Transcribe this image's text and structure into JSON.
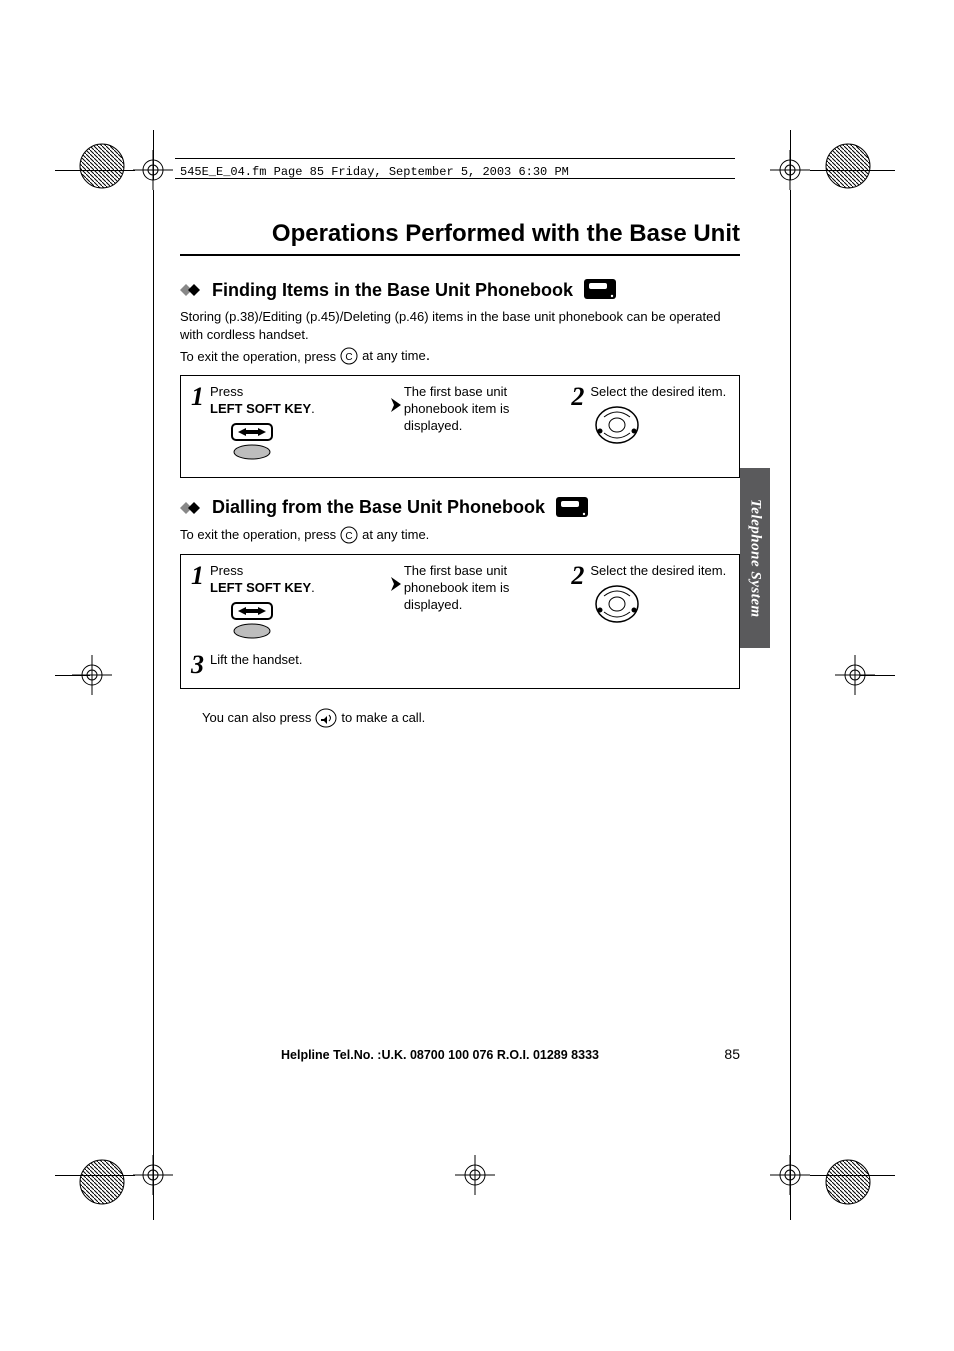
{
  "running_head": "545E_E_04.fm  Page 85  Friday, September 5, 2003  6:30 PM",
  "doc_title": "Operations Performed with the Base Unit",
  "side_tab": "Telephone System",
  "helpline": "Helpline Tel.No. :U.K. 08700 100 076  R.O.I. 01289 8333",
  "page_number": "85",
  "section1": {
    "title": "Finding Items in the Base Unit Phonebook",
    "intro1": "Storing (p.38)/Editing (p.45)/Deleting (p.46) items in the base unit phonebook can be operated with cordless handset.",
    "exit_pre": "To exit the operation, press",
    "exit_post": "at any time",
    "step1_pre": "Press",
    "step1_key": "LEFT SOFT KEY",
    "mid": "The first base unit phonebook item is displayed.",
    "step2": "Select the desired item."
  },
  "section2": {
    "title": "Dialling from the Base Unit Phonebook",
    "exit_pre": "To exit the operation, press",
    "exit_post": "at any time.",
    "step1_pre": "Press",
    "step1_key": "LEFT SOFT KEY",
    "mid": "The first base unit phonebook item is displayed.",
    "step2": "Select the desired item.",
    "step3": "Lift the handset.",
    "note_pre": "You can also press",
    "note_post": "to make a call."
  }
}
